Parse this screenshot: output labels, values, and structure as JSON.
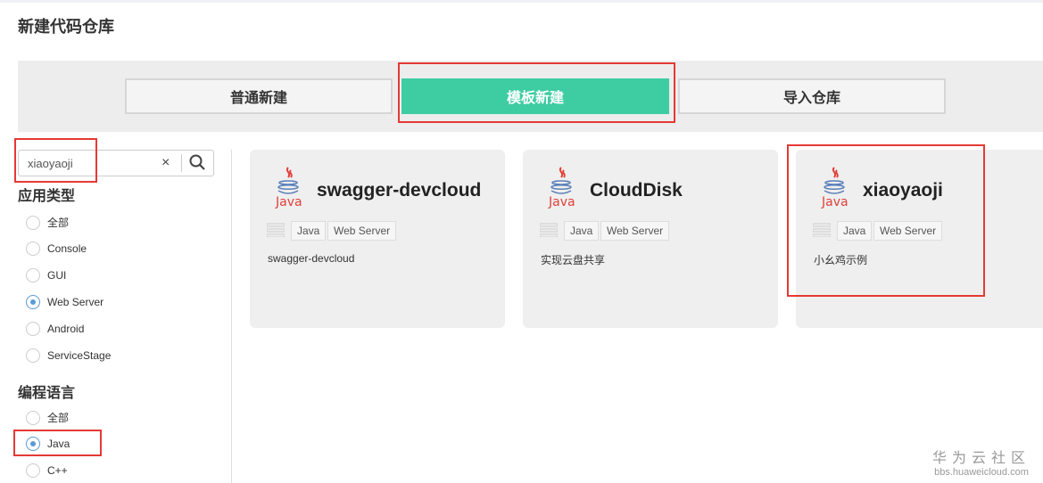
{
  "page_title": "新建代码仓库",
  "tabs": [
    {
      "label": "普通新建"
    },
    {
      "label": "模板新建"
    },
    {
      "label": "导入仓库"
    }
  ],
  "search": {
    "value": "xiaoyaoji",
    "clear_icon": "×"
  },
  "app_type": {
    "heading": "应用类型",
    "options": [
      "全部",
      "Console",
      "GUI",
      "Web Server",
      "Android",
      "ServiceStage"
    ],
    "selected": "Web Server"
  },
  "language": {
    "heading": "编程语言",
    "options": [
      "全部",
      "Java",
      "C++"
    ],
    "selected": "Java"
  },
  "cards": [
    {
      "name": "swagger-devcloud",
      "logo_text": "Java",
      "tags": [
        "Java",
        "Web Server"
      ],
      "desc": "swagger-devcloud"
    },
    {
      "name": "CloudDisk",
      "logo_text": "Java",
      "tags": [
        "Java",
        "Web Server"
      ],
      "desc": "实现云盘共享"
    },
    {
      "name": "xiaoyaoji",
      "logo_text": "Java",
      "tags": [
        "Java",
        "Web Server"
      ],
      "desc": "小幺鸡示例"
    }
  ],
  "watermark": {
    "line1": "华为云社区",
    "line2": "bbs.huaweicloud.com"
  },
  "colors": {
    "accent": "#3ecca3",
    "highlight": "#e53935",
    "radio": "#5b9bd5"
  }
}
